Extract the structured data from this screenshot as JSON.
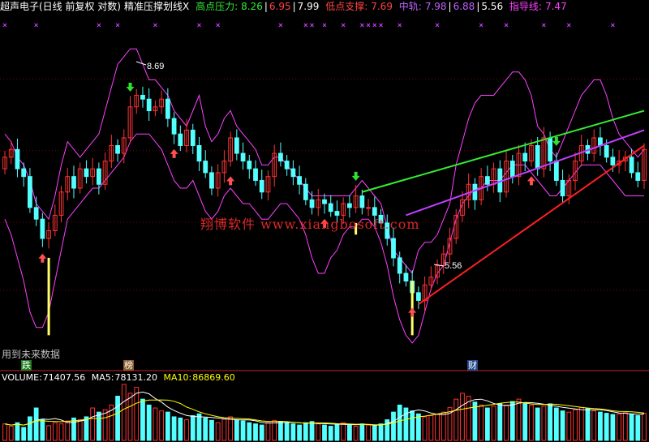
{
  "header": {
    "title": "超声电子(日线 前复权 对数)",
    "indicator_name": "精准压撑划线X",
    "high_resistance_label": "高点压力:",
    "high_resistance_values": [
      "8.26",
      "6.95",
      "7.99"
    ],
    "low_support_label": "低点支撑:",
    "low_support_value": "7.69",
    "mid_track_label": "中轨:",
    "mid_track_values": [
      "7.98",
      "6.88",
      "5.56"
    ],
    "guide_line_label": "指导线:",
    "guide_line_value": "7.47"
  },
  "colors": {
    "up_candle": "#ff3333",
    "down_candle": "#54ffff",
    "green_trend": "#33ee33",
    "purple_trend": "#c040ff",
    "red_trend": "#ff2020",
    "envelope": "#ff40ff",
    "signal_bar": "#ffff66",
    "ma5": "#ffffff",
    "ma10": "#ffff00"
  },
  "annotations": {
    "high_price": "8.69",
    "low_price": "5.56",
    "future_data_note": "用到未来数据",
    "watermark": "翔博软件 www.xiangbosoft.com"
  },
  "event_tags": {
    "drop": "跌",
    "list": "榜",
    "finance": "财"
  },
  "volume_header": {
    "volume_label": "VOLUME:",
    "volume_value": "71407.56",
    "ma5_label": "MA5:",
    "ma5_value": "78131.20",
    "ma10_label": "MA10:",
    "ma10_value": "86869.60"
  },
  "chart_data": {
    "type": "candlestick",
    "ylim": [
      5.0,
      9.4
    ],
    "closes": [
      7.6,
      7.7,
      7.45,
      7.35,
      6.95,
      6.8,
      6.55,
      6.65,
      6.85,
      7.15,
      7.35,
      7.2,
      7.45,
      7.35,
      7.45,
      7.25,
      7.55,
      7.75,
      7.65,
      7.85,
      8.25,
      8.4,
      8.35,
      8.2,
      8.25,
      8.35,
      8.1,
      7.9,
      7.75,
      7.95,
      7.75,
      7.55,
      7.4,
      7.2,
      7.4,
      7.55,
      7.85,
      7.65,
      7.55,
      7.45,
      7.3,
      7.15,
      7.35,
      7.65,
      7.55,
      7.45,
      7.35,
      7.25,
      7.05,
      6.95,
      7.05,
      7.0,
      6.9,
      6.85,
      7.0,
      6.95,
      7.1,
      6.95,
      6.95,
      6.85,
      6.75,
      6.55,
      6.3,
      6.1,
      6.0,
      5.85,
      5.75,
      5.95,
      6.05,
      6.2,
      6.35,
      6.55,
      6.85,
      7.05,
      7.25,
      7.05,
      7.35,
      7.25,
      7.45,
      7.15,
      7.55,
      7.35,
      7.65,
      7.55,
      7.75,
      7.45,
      7.85,
      7.55,
      7.3,
      7.1,
      7.3,
      7.55,
      7.75,
      7.65,
      7.85,
      7.75,
      7.6,
      7.5,
      7.55,
      7.6,
      7.4,
      7.3,
      7.7
    ],
    "opens": [
      7.45,
      7.6,
      7.7,
      7.45,
      7.35,
      6.95,
      6.8,
      6.55,
      6.65,
      6.85,
      7.15,
      7.35,
      7.2,
      7.45,
      7.35,
      7.45,
      7.25,
      7.55,
      7.75,
      7.65,
      7.85,
      8.25,
      8.4,
      8.35,
      8.2,
      8.25,
      8.35,
      8.1,
      7.9,
      7.75,
      7.95,
      7.75,
      7.55,
      7.4,
      7.2,
      7.4,
      7.55,
      7.85,
      7.65,
      7.55,
      7.45,
      7.3,
      7.15,
      7.35,
      7.65,
      7.55,
      7.45,
      7.35,
      7.25,
      7.05,
      6.95,
      7.05,
      7.0,
      6.9,
      6.85,
      7.0,
      6.95,
      7.1,
      6.95,
      6.95,
      6.85,
      6.75,
      6.55,
      6.3,
      6.1,
      6.0,
      5.85,
      5.75,
      5.95,
      6.05,
      6.2,
      6.35,
      6.55,
      6.85,
      7.05,
      7.25,
      7.05,
      7.35,
      7.25,
      7.45,
      7.15,
      7.55,
      7.35,
      7.65,
      7.55,
      7.75,
      7.45,
      7.85,
      7.55,
      7.3,
      7.1,
      7.3,
      7.55,
      7.75,
      7.65,
      7.85,
      7.75,
      7.6,
      7.5,
      7.55,
      7.6,
      7.4,
      7.3
    ],
    "envelope_upper": [
      7.9,
      7.8,
      7.6,
      7.5,
      7.3,
      7.0,
      6.9,
      6.8,
      7.1,
      7.5,
      7.8,
      7.7,
      7.6,
      7.7,
      7.8,
      7.9,
      8.2,
      8.5,
      8.8,
      8.9,
      9.0,
      9.0,
      8.8,
      8.6,
      8.6,
      8.5,
      8.4,
      8.2,
      8.1,
      8.0,
      8.2,
      8.4,
      8.0,
      7.8,
      7.9,
      8.1,
      8.2,
      8.0,
      7.9,
      7.8,
      7.7,
      7.5,
      7.5,
      7.6,
      7.6,
      7.5,
      7.4,
      7.3,
      7.2,
      7.1,
      7.1,
      7.1,
      7.1,
      7.1,
      7.1,
      7.1,
      7.2,
      7.3,
      7.2,
      7.1,
      7.0,
      6.7,
      6.4,
      6.3,
      6.2,
      6.1,
      6.4,
      6.5,
      6.5,
      6.6,
      6.8,
      7.0,
      7.5,
      7.8,
      8.1,
      8.3,
      8.4,
      8.4,
      8.4,
      8.5,
      8.6,
      8.7,
      8.7,
      8.6,
      8.4,
      8.0,
      7.9,
      7.7,
      7.6,
      7.8,
      8.0,
      8.2,
      8.4,
      8.5,
      8.6,
      8.6,
      8.4,
      8.1,
      7.9,
      7.8,
      7.7,
      7.6,
      7.7
    ],
    "envelope_lower": [
      6.8,
      6.6,
      6.3,
      6.0,
      5.6,
      5.4,
      5.4,
      5.6,
      6.0,
      6.4,
      6.8,
      6.9,
      7.0,
      7.1,
      7.2,
      7.2,
      7.3,
      7.4,
      7.5,
      7.6,
      7.8,
      7.9,
      7.9,
      7.9,
      7.8,
      7.7,
      7.5,
      7.3,
      7.2,
      7.2,
      7.3,
      7.1,
      6.9,
      6.8,
      6.9,
      7.1,
      7.2,
      7.1,
      7.0,
      7.0,
      6.9,
      6.8,
      6.8,
      6.9,
      7.0,
      7.0,
      6.9,
      6.8,
      6.6,
      6.3,
      6.1,
      6.1,
      6.3,
      6.4,
      6.6,
      6.7,
      6.7,
      6.8,
      6.8,
      6.7,
      6.5,
      6.2,
      5.8,
      5.5,
      5.3,
      5.2,
      5.3,
      5.6,
      5.9,
      6.1,
      6.2,
      6.5,
      6.8,
      7.0,
      7.1,
      7.2,
      7.2,
      7.3,
      7.3,
      7.3,
      7.4,
      7.5,
      7.5,
      7.5,
      7.4,
      7.3,
      7.2,
      7.1,
      7.1,
      7.2,
      7.3,
      7.4,
      7.5,
      7.5,
      7.5,
      7.5,
      7.4,
      7.3,
      7.2,
      7.1,
      7.1,
      7.1,
      7.1
    ],
    "volume": [
      28,
      24,
      30,
      22,
      40,
      55,
      35,
      25,
      30,
      28,
      33,
      38,
      35,
      40,
      55,
      48,
      52,
      60,
      75,
      95,
      80,
      90,
      70,
      60,
      55,
      50,
      48,
      40,
      38,
      35,
      42,
      45,
      38,
      34,
      30,
      36,
      40,
      35,
      33,
      30,
      28,
      26,
      30,
      34,
      32,
      30,
      28,
      26,
      30,
      32,
      28,
      26,
      24,
      28,
      30,
      26,
      24,
      28,
      26,
      25,
      28,
      35,
      48,
      60,
      55,
      50,
      45,
      40,
      42,
      44,
      48,
      56,
      70,
      80,
      75,
      65,
      60,
      55,
      58,
      62,
      60,
      66,
      70,
      64,
      60,
      55,
      58,
      62,
      55,
      50,
      48,
      52,
      56,
      54,
      50,
      48,
      46,
      44,
      45,
      47,
      44,
      42,
      46
    ],
    "signal_bars": [
      {
        "index": 7,
        "low": 5.3,
        "high": 6.3
      },
      {
        "index": 56,
        "low": 6.6,
        "high": 6.75
      },
      {
        "index": 65,
        "low": 5.3,
        "high": 6.0
      }
    ],
    "trend_lines": [
      {
        "name": "green",
        "from": [
          57,
          7.15
        ],
        "to": [
          102,
          8.2
        ]
      },
      {
        "name": "purple",
        "from": [
          64,
          6.85
        ],
        "to": [
          102,
          7.95
        ]
      },
      {
        "name": "red",
        "from": [
          66,
          5.7
        ],
        "to": [
          102,
          7.75
        ]
      }
    ],
    "arrows_up": [
      6,
      27,
      36,
      51,
      65,
      84
    ],
    "arrows_down": [
      20,
      56,
      88
    ]
  }
}
